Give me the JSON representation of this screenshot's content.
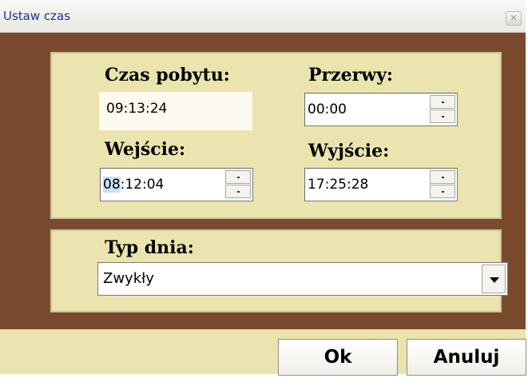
{
  "window": {
    "title": "Ustaw czas",
    "close_icon": "close-icon",
    "colors": {
      "background": "#ebe4ae",
      "frame": "#7a4a2e",
      "title_text": "#123a8c"
    }
  },
  "time_panel": {
    "stay_time": {
      "label": "Czas pobytu:",
      "value": "09:13:24"
    },
    "breaks": {
      "label": "Przerwy:",
      "value": "00:00"
    },
    "entry": {
      "label": "Wejście:",
      "value_selected": "08",
      "value_rest": ":12:04"
    },
    "exit": {
      "label": "Wyjście:",
      "value": "17:25:28"
    }
  },
  "day_type_panel": {
    "label": "Typ dnia:",
    "selected": "Zwykły"
  },
  "buttons": {
    "ok": "Ok",
    "cancel": "Anuluj"
  }
}
